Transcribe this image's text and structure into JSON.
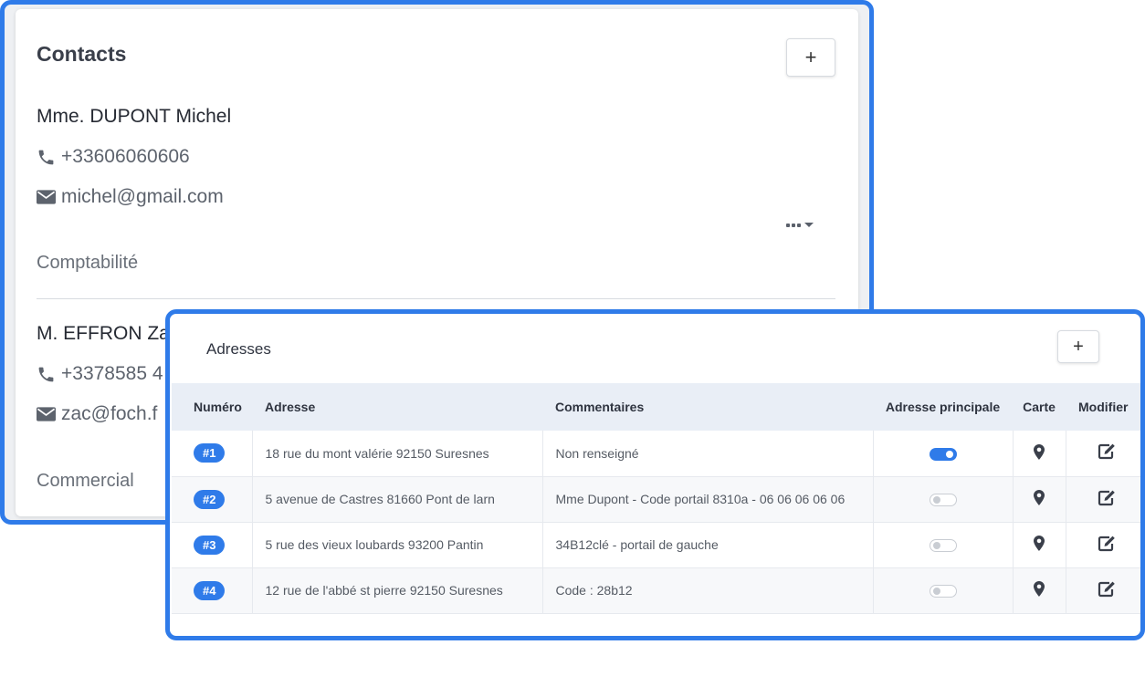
{
  "contacts": {
    "title": "Contacts",
    "add_label": "+",
    "items": [
      {
        "name": "Mme. DUPONT Michel",
        "phone": "+33606060606",
        "email": "michel@gmail.com",
        "role": "Comptabilité"
      },
      {
        "name": "M. EFFRON Za",
        "phone": "+3378585 4",
        "email": "zac@foch.f",
        "role": "Commercial"
      }
    ]
  },
  "adresses": {
    "title": "Adresses",
    "add_label": "+",
    "columns": {
      "numero": "Numéro",
      "adresse": "Adresse",
      "commentaires": "Commentaires",
      "principale": "Adresse principale",
      "carte": "Carte",
      "modifier": "Modifier"
    },
    "rows": [
      {
        "num": "#1",
        "adresse": "18 rue du mont valérie 92150 Suresnes",
        "commentaire": "Non renseigné",
        "principale": true
      },
      {
        "num": "#2",
        "adresse": "5 avenue de Castres 81660 Pont de larn",
        "commentaire": "Mme Dupont - Code portail 8310a - 06 06 06 06 06",
        "principale": false
      },
      {
        "num": "#3",
        "adresse": "5 rue des vieux loubards 93200 Pantin",
        "commentaire": "34B12clé - portail de gauche",
        "principale": false
      },
      {
        "num": "#4",
        "adresse": "12 rue de l'abbé st pierre 92150 Suresnes",
        "commentaire": "Code : 28b12",
        "principale": false
      }
    ]
  },
  "icons": {
    "phone": "phone-icon",
    "email": "envelope-icon",
    "map": "map-marker-icon",
    "edit": "edit-icon",
    "more": "more-dots-icon"
  },
  "colors": {
    "accent": "#2f7be9"
  }
}
